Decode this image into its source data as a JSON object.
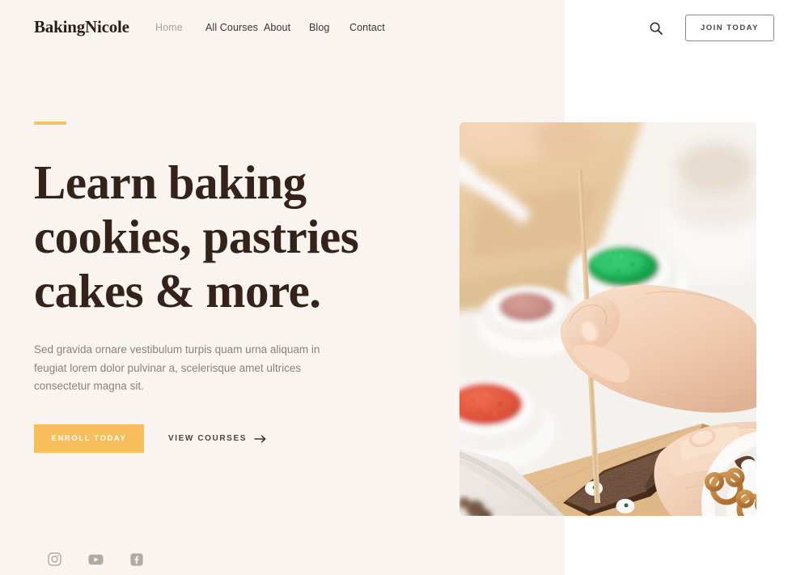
{
  "header": {
    "logo": "BakingNicole",
    "nav": [
      {
        "label": "Home",
        "active": true
      },
      {
        "label": "All Courses",
        "active": false
      },
      {
        "label": "About",
        "active": false
      },
      {
        "label": "Blog",
        "active": false
      },
      {
        "label": "Contact",
        "active": false
      }
    ],
    "search_icon": "search-icon",
    "join_label": "JOIN TODAY"
  },
  "hero": {
    "accent_bar": "gold-accent-bar",
    "headline": "Learn baking cookies, pastries cakes & more.",
    "headline_lines": [
      "Learn baking",
      "cookies, pastries",
      "cakes & more."
    ],
    "subtext": "Sed gravida ornare vestibulum turpis quam urna aliquam in feugiat lorem dolor pulvinar a, scelerisque amet ultrices consectetur magna sit.",
    "primary_cta": "ENROLL TODAY",
    "secondary_cta": "VIEW COURSES",
    "secondary_cta_arrow": "→",
    "image_alt": "Hands decorating a chocolate brownie with a wooden skewer on a cutting board, bowls of red and green sprinkles nearby, pretzels on a white plate"
  },
  "social": [
    {
      "name": "instagram-icon",
      "label": "Instagram"
    },
    {
      "name": "youtube-icon",
      "label": "YouTube"
    },
    {
      "name": "facebook-icon",
      "label": "Facebook"
    }
  ],
  "colors": {
    "background_cream": "#faf4f0",
    "background_white": "#ffffff",
    "headline_brown": "#34231a",
    "accent_gold": "#f2c464",
    "button_gold": "#f7be5b",
    "body_text": "#8b817c",
    "nav_text": "#3a3532",
    "nav_active": "#a9a29d",
    "social_icon": "#b3a9a3"
  }
}
